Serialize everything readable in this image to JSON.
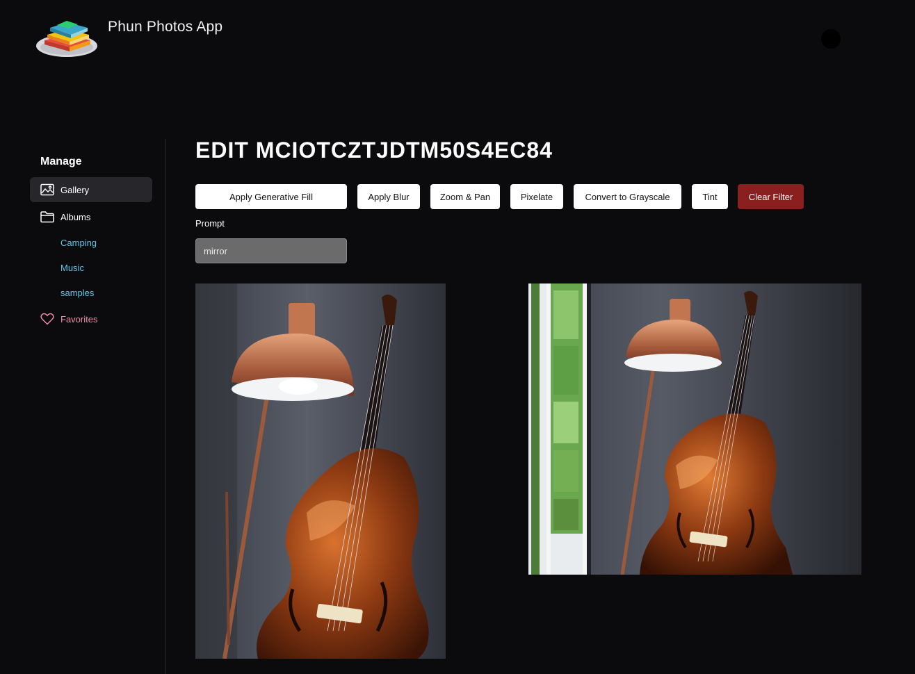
{
  "header": {
    "app_title": "Phun Photos App"
  },
  "sidebar": {
    "heading": "Manage",
    "items": [
      {
        "label": "Gallery",
        "icon": "image-icon",
        "active": true
      },
      {
        "label": "Albums",
        "icon": "folder-icon",
        "active": false
      }
    ],
    "albums": [
      "Camping",
      "Music",
      "samples"
    ],
    "favorites": {
      "label": "Favorites",
      "icon": "heart-icon"
    }
  },
  "main": {
    "title": "EDIT MCIOTCZTJDTM50S4EC84",
    "buttons": {
      "generative_fill": "Apply Generative Fill",
      "blur": "Apply Blur",
      "zoom_pan": "Zoom & Pan",
      "pixelate": "Pixelate",
      "grayscale": "Convert to Grayscale",
      "tint": "Tint",
      "clear_filter": "Clear Filter"
    },
    "prompt": {
      "label": "Prompt",
      "value": "mirror"
    },
    "images": [
      {
        "name": "original-photo",
        "subject": "copper lamp and double bass"
      },
      {
        "name": "edited-photo",
        "subject": "copper lamp and double bass with generative fill window"
      }
    ]
  },
  "colors": {
    "background": "#0b0b0e",
    "active_nav": "#27272b",
    "album_link": "#5fc6e6",
    "favorites": "#f08aa8",
    "clear_button": "#8a1f1f"
  }
}
